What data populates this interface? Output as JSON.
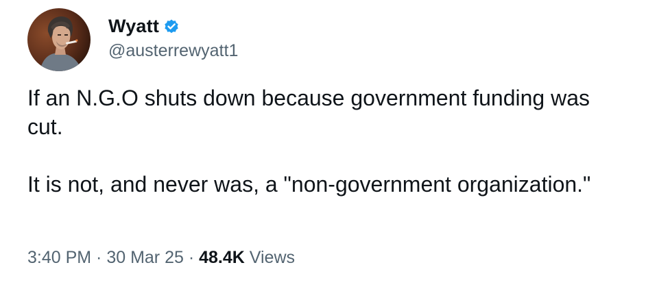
{
  "author": {
    "display_name": "Wyatt",
    "handle": "@austerrewyatt1",
    "verified_icon": "verified-badge-icon",
    "avatar": "profile-photo"
  },
  "tweet": {
    "paragraphs": [
      "If an N.G.O shuts down because government funding was cut.",
      "It is not, and never was, a \"non-government organization.\""
    ]
  },
  "meta": {
    "time": "3:40 PM",
    "separator": " · ",
    "date": "30 Mar 25",
    "views_count": "48.4K",
    "views_label": " Views"
  },
  "colors": {
    "text": "#0f1419",
    "secondary": "#536471",
    "verified": "#1d9bf0"
  }
}
